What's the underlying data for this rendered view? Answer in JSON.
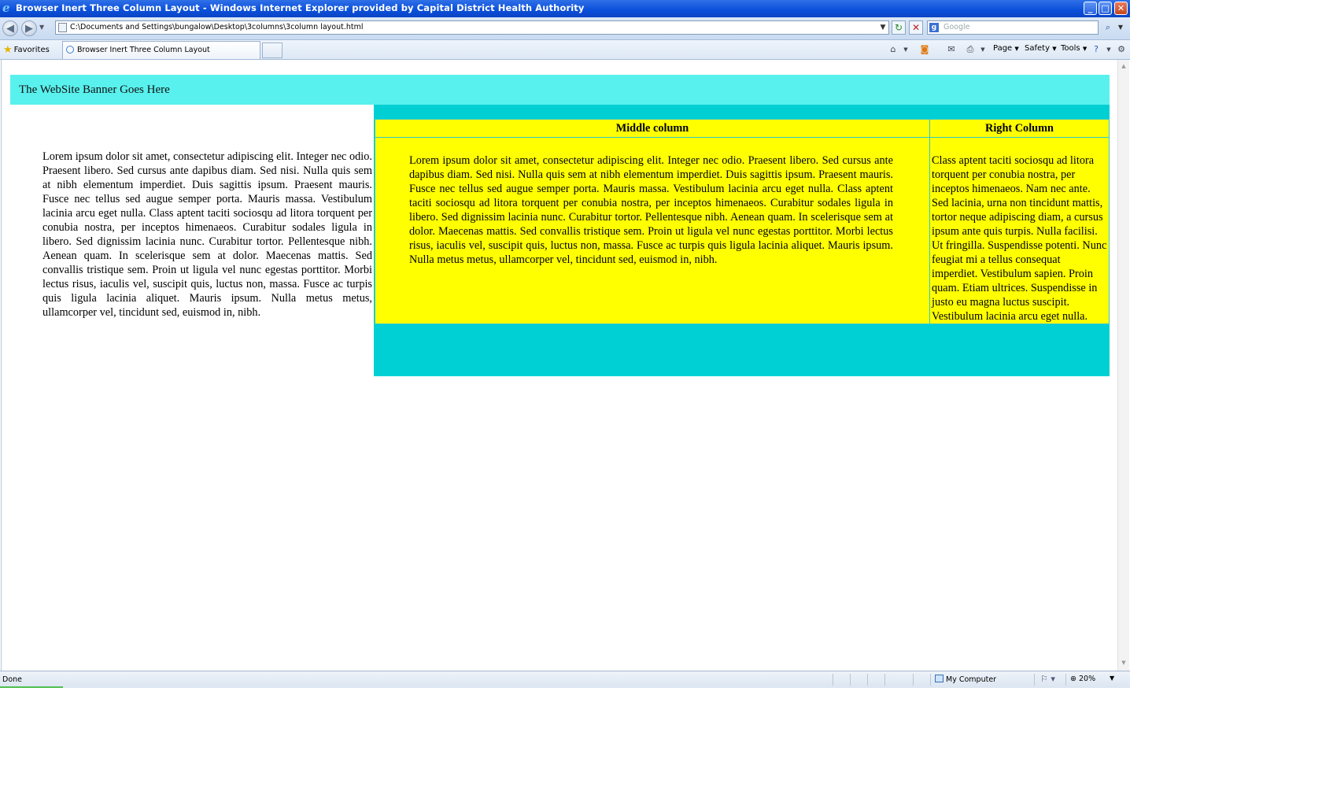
{
  "window": {
    "title": "Browser Inert Three Column Layout - Windows Internet Explorer provided by Capital District Health Authority"
  },
  "toolbar": {
    "address": "C:\\Documents and Settings\\bungalow\\Desktop\\3columns\\3column layout.html",
    "search_placeholder": "Google"
  },
  "favorites": {
    "label": "Favorites",
    "active_tab": "Browser Inert Three Column Layout"
  },
  "commands": {
    "page": "Page",
    "safety": "Safety",
    "tools": "Tools"
  },
  "page": {
    "banner": "The WebSite Banner Goes Here",
    "left_text": "Lorem ipsum dolor sit amet, consectetur adipiscing elit. Integer nec odio. Praesent libero. Sed cursus ante dapibus diam. Sed nisi. Nulla quis sem at nibh elementum imperdiet. Duis sagittis ipsum. Praesent mauris. Fusce nec tellus sed augue semper porta. Mauris massa. Vestibulum lacinia arcu eget nulla. Class aptent taciti sociosqu ad litora torquent per conubia nostra, per inceptos himenaeos. Curabitur sodales ligula in libero. Sed dignissim lacinia nunc. Curabitur tortor. Pellentesque nibh. Aenean quam. In scelerisque sem at dolor. Maecenas mattis. Sed convallis tristique sem. Proin ut ligula vel nunc egestas porttitor. Morbi lectus risus, iaculis vel, suscipit quis, luctus non, massa. Fusce ac turpis quis ligula lacinia aliquet. Mauris ipsum. Nulla metus metus, ullamcorper vel, tincidunt sed, euismod in, nibh.",
    "middle_header": "Middle column",
    "right_header": "Right Column",
    "middle_text": "Lorem ipsum dolor sit amet, consectetur adipiscing elit. Integer nec odio. Praesent libero. Sed cursus ante dapibus diam. Sed nisi. Nulla quis sem at nibh elementum imperdiet. Duis sagittis ipsum. Praesent mauris. Fusce nec tellus sed augue semper porta. Mauris massa. Vestibulum lacinia arcu eget nulla. Class aptent taciti sociosqu ad litora torquent per conubia nostra, per inceptos himenaeos. Curabitur sodales ligula in libero. Sed dignissim lacinia nunc. Curabitur tortor. Pellentesque nibh. Aenean quam. In scelerisque sem at dolor. Maecenas mattis. Sed convallis tristique sem. Proin ut ligula vel nunc egestas porttitor. Morbi lectus risus, iaculis vel, suscipit quis, luctus non, massa. Fusce ac turpis quis ligula lacinia aliquet. Mauris ipsum. Nulla metus metus, ullamcorper vel, tincidunt sed, euismod in, nibh.",
    "right_text": "Class aptent taciti sociosqu ad litora torquent per conubia nostra, per inceptos himenaeos. Nam nec ante. Sed lacinia, urna non tincidunt mattis, tortor neque adipiscing diam, a cursus ipsum ante quis turpis. Nulla facilisi. Ut fringilla. Suspendisse potenti. Nunc feugiat mi a tellus consequat imperdiet. Vestibulum sapien. Proin quam. Etiam ultrices. Suspendisse in justo eu magna luctus suscipit. Vestibulum lacinia arcu eget nulla."
  },
  "status": {
    "text": "Done",
    "zone": "My Computer",
    "zoom": "20%"
  },
  "colors": {
    "banner": "#59f1ee",
    "main_bg": "#00d0d4",
    "columns_bg": "#ffff00",
    "titlebar": "#0a4fd9"
  }
}
